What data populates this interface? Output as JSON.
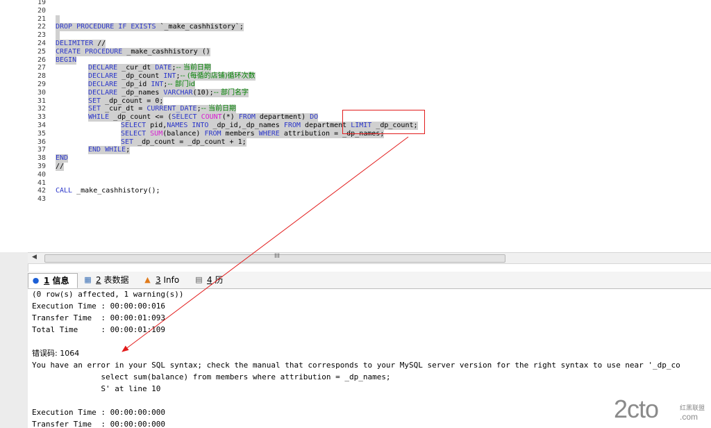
{
  "editor": {
    "lines": [
      {
        "num": "19",
        "segs": []
      },
      {
        "num": "20",
        "segs": []
      },
      {
        "num": "21",
        "sel": true,
        "segs": []
      },
      {
        "num": "22",
        "indent": 0,
        "sel": true,
        "segs": [
          [
            "kw",
            "DROP PROCEDURE IF EXISTS "
          ],
          [
            "id",
            "`_make_cashhistory`;"
          ]
        ]
      },
      {
        "num": "23",
        "sel": true,
        "segs": []
      },
      {
        "num": "24",
        "indent": 0,
        "sel": true,
        "segs": [
          [
            "kw",
            "DELIMITER "
          ],
          [
            "id",
            "//"
          ]
        ]
      },
      {
        "num": "25",
        "indent": 0,
        "sel": true,
        "segs": [
          [
            "kw",
            "CREATE PROCEDURE "
          ],
          [
            "id",
            "_make_cashhistory ()"
          ]
        ]
      },
      {
        "num": "26",
        "indent": 0,
        "sel": true,
        "segs": [
          [
            "kw",
            "BEGIN"
          ]
        ]
      },
      {
        "num": "27",
        "indent": 1,
        "sel": true,
        "segs": [
          [
            "kw",
            "DECLARE "
          ],
          [
            "id",
            "_cur_dt "
          ],
          [
            "kw",
            "DATE"
          ],
          [
            "sym",
            ";"
          ],
          [
            "cm",
            "-- 当前日期"
          ]
        ]
      },
      {
        "num": "28",
        "indent": 1,
        "sel": true,
        "segs": [
          [
            "kw",
            "DECLARE "
          ],
          [
            "id",
            "_dp_count "
          ],
          [
            "kw",
            "INT"
          ],
          [
            "sym",
            ";"
          ],
          [
            "cm",
            "-- (每循的店铺)循环次数"
          ]
        ]
      },
      {
        "num": "29",
        "indent": 1,
        "sel": true,
        "segs": [
          [
            "kw",
            "DECLARE "
          ],
          [
            "id",
            "_dp_id "
          ],
          [
            "kw",
            "INT"
          ],
          [
            "sym",
            ";"
          ],
          [
            "cm",
            "-- 部门id"
          ]
        ]
      },
      {
        "num": "30",
        "indent": 1,
        "sel": true,
        "segs": [
          [
            "kw",
            "DECLARE "
          ],
          [
            "id",
            "_dp_names "
          ],
          [
            "kw",
            "VARCHAR"
          ],
          [
            "id",
            "(10);"
          ],
          [
            "cm",
            "-- 部门名字"
          ]
        ]
      },
      {
        "num": "31",
        "indent": 1,
        "sel": true,
        "segs": [
          [
            "kw",
            "SET "
          ],
          [
            "id",
            "_dp_count = 0;"
          ]
        ]
      },
      {
        "num": "32",
        "indent": 1,
        "sel": true,
        "segs": [
          [
            "kw",
            "SET "
          ],
          [
            "id",
            "_cur_dt = "
          ],
          [
            "kw",
            "CURRENT_DATE"
          ],
          [
            "sym",
            ";"
          ],
          [
            "cm",
            "-- 当前日期"
          ]
        ]
      },
      {
        "num": "33",
        "indent": 1,
        "sel": true,
        "segs": [
          [
            "kw",
            "WHILE "
          ],
          [
            "id",
            "_dp_count <= ("
          ],
          [
            "kw",
            "SELECT "
          ],
          [
            "fn",
            "COUNT"
          ],
          [
            "id",
            "(*) "
          ],
          [
            "kw",
            "FROM "
          ],
          [
            "id",
            "department) "
          ],
          [
            "kw",
            "DO"
          ]
        ]
      },
      {
        "num": "34",
        "indent": 2,
        "sel": true,
        "segs": [
          [
            "kw",
            "SELECT "
          ],
          [
            "id",
            "pid,"
          ],
          [
            "kw",
            "NAMES INTO "
          ],
          [
            "id",
            "_dp_id,_dp_names "
          ],
          [
            "kw",
            "FROM "
          ],
          [
            "id",
            "department "
          ],
          [
            "kw",
            "LIMIT "
          ],
          [
            "id",
            "_dp_count;"
          ]
        ]
      },
      {
        "num": "35",
        "indent": 2,
        "sel": true,
        "segs": [
          [
            "kw",
            "SELECT "
          ],
          [
            "fn",
            "SUM"
          ],
          [
            "id",
            "(balance) "
          ],
          [
            "kw",
            "FROM "
          ],
          [
            "id",
            "members "
          ],
          [
            "kw",
            "WHERE "
          ],
          [
            "id",
            "attribution = _dp_names;"
          ]
        ]
      },
      {
        "num": "36",
        "indent": 2,
        "sel": true,
        "segs": [
          [
            "kw",
            "SET "
          ],
          [
            "id",
            "_dp_count = _dp_count + 1;"
          ]
        ]
      },
      {
        "num": "37",
        "indent": 1,
        "sel": true,
        "segs": [
          [
            "kw",
            "END WHILE"
          ],
          [
            "sym",
            ";"
          ]
        ]
      },
      {
        "num": "38",
        "indent": 0,
        "sel": true,
        "segs": [
          [
            "kw",
            "END"
          ]
        ]
      },
      {
        "num": "39",
        "indent": 0,
        "sel": true,
        "segs": [
          [
            "id",
            "//"
          ]
        ]
      },
      {
        "num": "40",
        "segs": []
      },
      {
        "num": "41",
        "segs": []
      },
      {
        "num": "42",
        "indent": 0,
        "segs": [
          [
            "kw",
            "CALL "
          ],
          [
            "id",
            "_make_cashhistory();"
          ]
        ]
      },
      {
        "num": "43",
        "segs": []
      }
    ]
  },
  "scrollbar": {
    "grip": "III",
    "arrow": "◀"
  },
  "tabs": [
    {
      "num": "1",
      "label": " 信息",
      "icon": "info-icon",
      "glyph": "●",
      "active": true
    },
    {
      "num": "2",
      "label": " 表数据",
      "icon": "table-icon",
      "glyph": "▦",
      "active": false
    },
    {
      "num": "3",
      "label": " Info",
      "icon": "chart-icon",
      "glyph": "▲",
      "active": false
    },
    {
      "num": "4",
      "label": " 历史",
      "icon": "calendar-icon",
      "glyph": "▤",
      "active": false
    }
  ],
  "output": {
    "lines": [
      "(0 row(s) affected, 1 warning(s))",
      "Execution Time : 00:00:00:016",
      "Transfer Time  : 00:00:01:093",
      "Total Time     : 00:00:01:109",
      "",
      "错误码: 1064",
      "You have an error in your SQL syntax; check the manual that corresponds to your MySQL server version for the right syntax to use near '_dp_co",
      "               select sum(balance) from members where attribution = _dp_names;",
      "               S' at line 10",
      "",
      "Execution Time : 00:00:00:000",
      "Transfer Time  : 00:00:00:000"
    ]
  },
  "watermark": {
    "main": "2cto",
    "cn": "红黑联盟",
    "com": ".com"
  },
  "annotation_color": "#e21b1b"
}
